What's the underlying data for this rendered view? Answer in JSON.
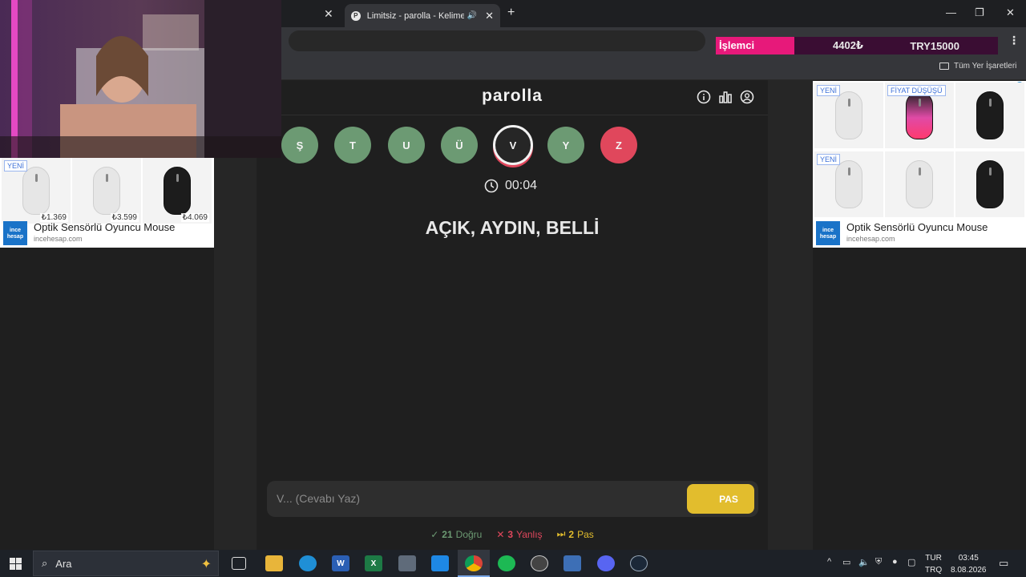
{
  "browser": {
    "active_tab_title": "Limitsiz - parolla - Kelime oyunu",
    "bookmarks_all": "Tüm Yer İşaretleri"
  },
  "banner": {
    "label": "İşlemci",
    "price": "4402₺",
    "code": "TRY15000"
  },
  "game": {
    "logo": "parolla",
    "letters": [
      {
        "letter": "Ş",
        "state": "correct"
      },
      {
        "letter": "T",
        "state": "correct"
      },
      {
        "letter": "U",
        "state": "correct"
      },
      {
        "letter": "Ü",
        "state": "correct"
      },
      {
        "letter": "V",
        "state": "active"
      },
      {
        "letter": "Y",
        "state": "correct"
      },
      {
        "letter": "Z",
        "state": "wrong"
      }
    ],
    "timer": "00:04",
    "clue": "AÇIK, AYDIN, BELLİ",
    "input_placeholder": "V... (Cevabı Yaz)",
    "pass_button": "PAS",
    "stats": {
      "correct_count": "21",
      "correct_label": "Doğru",
      "wrong_count": "3",
      "wrong_label": "Yanlış",
      "pass_count": "2",
      "pass_label": "Pas"
    }
  },
  "ad_left": {
    "tag_new": "YENİ",
    "prices": [
      "₺1.369",
      "₺3.599",
      "₺4.069"
    ],
    "title": "Optik Sensörlü Oyuncu Mouse",
    "url": "incehesap.com",
    "logo_text": "ince hesap"
  },
  "ad_right": {
    "tag_new": "YENİ",
    "tag_drop": "FİYAT DÜŞÜŞÜ",
    "tag_new2": "YENİ",
    "title": "Optik Sensörlü Oyuncu Mouse",
    "url": "incehesap.com",
    "logo_text": "ince hesap"
  },
  "taskbar": {
    "search_text": "Ara",
    "lang1": "TUR",
    "lang2": "TRQ",
    "time": "03:45",
    "date": "8.08.2026"
  },
  "colors": {
    "correct": "#6c9a73",
    "wrong": "#e0475c",
    "pass": "#e2bd2d",
    "banner_pink": "#e7197a"
  }
}
